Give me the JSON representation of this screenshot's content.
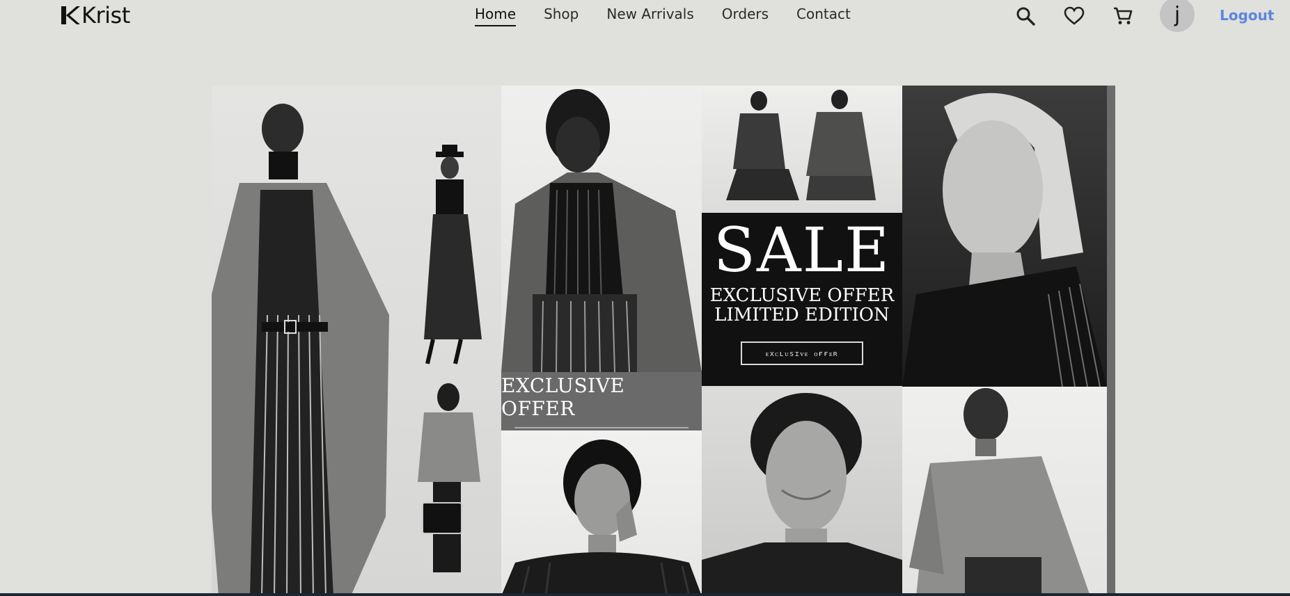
{
  "brand": {
    "name": "Krist"
  },
  "nav": {
    "items": [
      {
        "label": "Home",
        "active": true
      },
      {
        "label": "Shop",
        "active": false
      },
      {
        "label": "New Arrivals",
        "active": false
      },
      {
        "label": "Orders",
        "active": false
      },
      {
        "label": "Contact",
        "active": false
      }
    ]
  },
  "header_icons": [
    "search-icon",
    "heart-icon",
    "cart-icon"
  ],
  "user": {
    "initial": "j",
    "logout_label": "Logout"
  },
  "banner": {
    "sale_title": "SALE",
    "sale_line1": "EXCLUSIVE OFFER",
    "sale_line2": "LIMITED EDITION",
    "sale_button": "ᴇxᴄʟᴜsɪᴠᴇ ᴏғғᴇʀ",
    "exclusive_band": "EXCLUSIVE OFFER"
  },
  "colors": {
    "background": "#e0e0dc",
    "logout": "#5a86e0",
    "text": "#2a2a2a"
  }
}
